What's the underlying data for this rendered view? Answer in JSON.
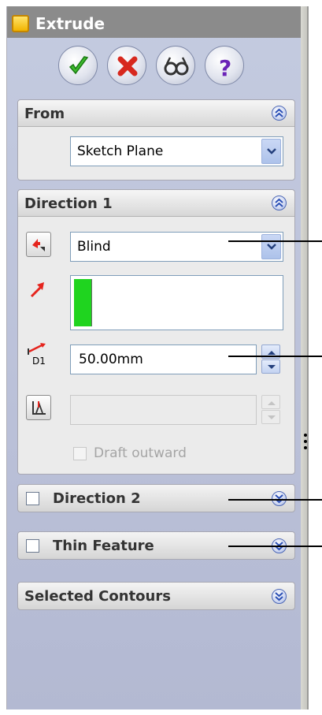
{
  "window": {
    "title": "Extrude"
  },
  "actions": [
    {
      "name": "ok",
      "icon": "green-check-icon"
    },
    {
      "name": "cancel",
      "icon": "red-x-icon"
    },
    {
      "name": "preview",
      "icon": "glasses-icon"
    },
    {
      "name": "help",
      "icon": "question-icon"
    }
  ],
  "from": {
    "title": "From",
    "selected": "Sketch Plane"
  },
  "direction1": {
    "title": "Direction 1",
    "end_condition": "Blind",
    "depth": "50.00mm",
    "draft_outward_label": "Draft outward"
  },
  "direction2": {
    "title": "Direction 2",
    "checked": false
  },
  "thin_feature": {
    "title": "Thin Feature",
    "checked": false
  },
  "selected_contours": {
    "title": "Selected Contours"
  },
  "colors": {
    "accent_green": "#1fd41f",
    "accent_red": "#e5241d",
    "chevron_blue": "#2a4fb5"
  }
}
